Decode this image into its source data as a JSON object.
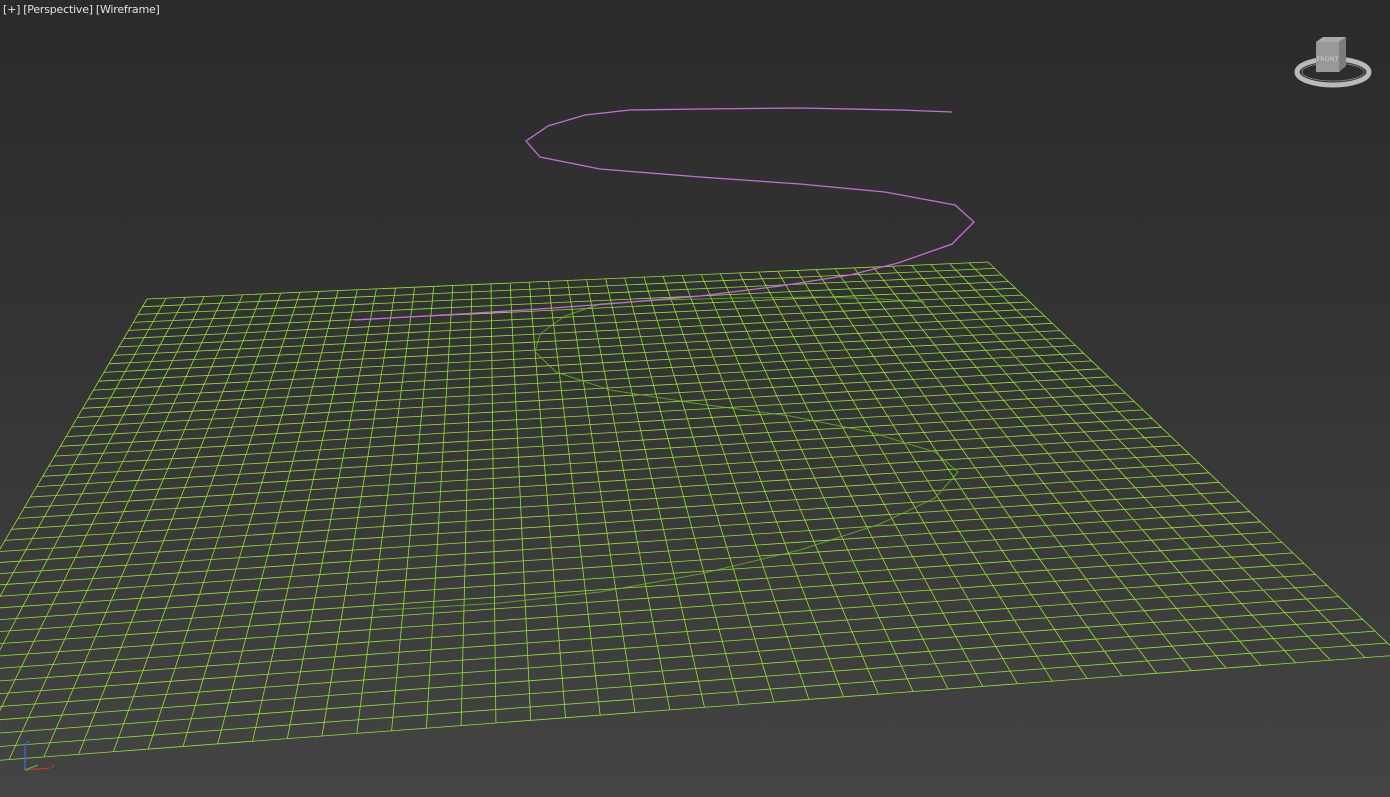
{
  "viewport": {
    "plus_menu": "[+]",
    "view_menu": "[Perspective]",
    "shading_menu": "[Wireframe]"
  },
  "viewcube": {
    "face_label": "FRONT"
  },
  "colors": {
    "grid": "#8ee52c",
    "spline": "#c86adc",
    "spline_on_plane": "#6fbf24",
    "label": "#e2e2e2",
    "axis_x": "#d23030",
    "axis_y": "#4ec83c",
    "axis_z": "#3f6fe0"
  },
  "axis_tripod": {
    "x": "x",
    "y": "y",
    "z": "z"
  }
}
